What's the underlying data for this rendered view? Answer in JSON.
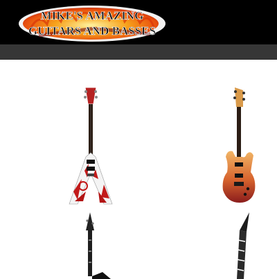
{
  "site": {
    "logo_text": "MIKE'S AMAZING GUITARS AND BASSES",
    "logo_line1": "MIKE'S AMAZING",
    "logo_line2": "GUITARS AND BASSES"
  },
  "colors": {
    "header_bg": "#000000",
    "nav_bg": "#363636",
    "page_bg": "#ffffff",
    "logo_flame": "#e8500f",
    "logo_text": "#111111"
  },
  "products": [
    {
      "name": "red-white-flying-v-guitar",
      "icon": "flying-v-guitar"
    },
    {
      "name": "amber-burst-superstrat-guitar",
      "icon": "superstrat-guitar"
    },
    {
      "name": "black-pointy-guitar",
      "icon": "pointy-guitar"
    },
    {
      "name": "black-white-pointy-guitar",
      "icon": "pointy-guitar"
    }
  ]
}
